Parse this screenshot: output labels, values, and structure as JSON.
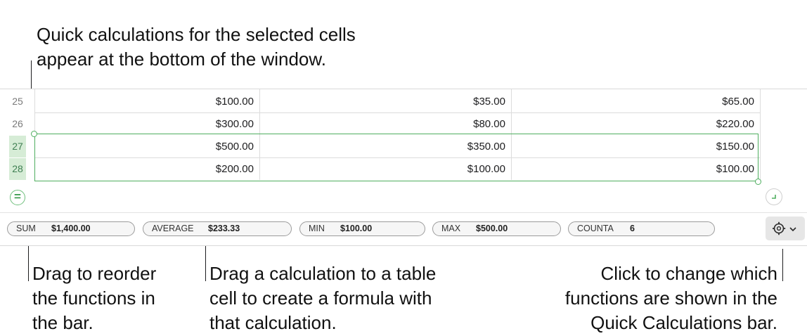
{
  "callouts": {
    "top": [
      "Quick calculations for the selected cells",
      "appear at the bottom of the window."
    ],
    "left": [
      "Drag to reorder",
      "the functions in",
      "the bar."
    ],
    "middle": [
      "Drag a calculation to a table",
      "cell to create a formula with",
      "that calculation."
    ],
    "right": [
      "Click to change which",
      "functions are shown in the",
      "Quick Calculations bar."
    ]
  },
  "table": {
    "row_numbers": [
      "25",
      "26",
      "27",
      "28"
    ],
    "selected_rows": [
      "27",
      "28"
    ],
    "rows": [
      [
        "$100.00",
        "$35.00",
        "$65.00"
      ],
      [
        "$300.00",
        "$80.00",
        "$220.00"
      ],
      [
        "$500.00",
        "$350.00",
        "$150.00"
      ],
      [
        "$200.00",
        "$100.00",
        "$100.00"
      ]
    ]
  },
  "controls": {
    "equals_symbol": "=",
    "gear_icon": "gear-icon",
    "chevron_icon": "chevron-down-icon"
  },
  "quick_calc": [
    {
      "name": "SUM",
      "value": "$1,400.00"
    },
    {
      "name": "AVERAGE",
      "value": "$233.33"
    },
    {
      "name": "MIN",
      "value": "$100.00"
    },
    {
      "name": "MAX",
      "value": "$500.00"
    },
    {
      "name": "COUNTA",
      "value": "6"
    }
  ],
  "colors": {
    "selection": "#4fae5f",
    "selected_row_header": "#d6ecd6"
  }
}
